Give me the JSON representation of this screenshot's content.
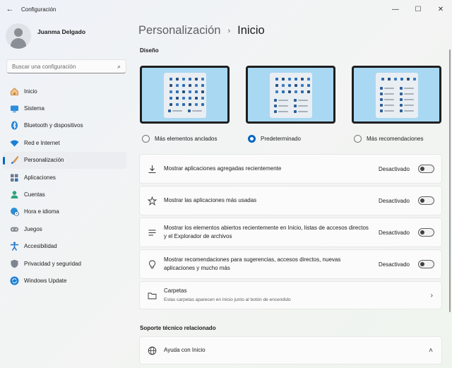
{
  "window": {
    "title": "Configuración",
    "back_icon": "←",
    "min_icon": "—",
    "max_icon": "☐",
    "close_icon": "✕"
  },
  "user": {
    "name": "Juanma Delgado"
  },
  "search": {
    "placeholder": "Buscar una configuración",
    "icon": "⌕"
  },
  "sidebar": {
    "items": [
      {
        "label": "Inicio",
        "icon": "home-icon",
        "color": "#d89a4a"
      },
      {
        "label": "Sistema",
        "icon": "monitor-icon",
        "color": "#0078d4"
      },
      {
        "label": "Bluetooth y dispositivos",
        "icon": "bluetooth-icon",
        "color": "#0078d4"
      },
      {
        "label": "Red e Internet",
        "icon": "wifi-icon",
        "color": "#0078d4"
      },
      {
        "label": "Personalización",
        "icon": "brush-icon",
        "color": "#e08c3a"
      },
      {
        "label": "Aplicaciones",
        "icon": "apps-icon",
        "color": "#3a6fb0"
      },
      {
        "label": "Cuentas",
        "icon": "person-icon",
        "color": "#2fa37c"
      },
      {
        "label": "Hora e idioma",
        "icon": "globe-clock-icon",
        "color": "#1a86c8"
      },
      {
        "label": "Juegos",
        "icon": "gamepad-icon",
        "color": "#7a7f86"
      },
      {
        "label": "Accesibilidad",
        "icon": "accessibility-icon",
        "color": "#1a73c8"
      },
      {
        "label": "Privacidad y seguridad",
        "icon": "shield-icon",
        "color": "#6b7280"
      },
      {
        "label": "Windows Update",
        "icon": "update-icon",
        "color": "#0078d4"
      }
    ],
    "active_index": 4
  },
  "breadcrumb": {
    "parent": "Personalización",
    "separator": "›",
    "current": "Inicio"
  },
  "layout_section": {
    "title": "Diseño",
    "options": [
      {
        "label": "Más elementos anclados",
        "selected": false
      },
      {
        "label": "Predeterminado",
        "selected": true
      },
      {
        "label": "Más recomendaciones",
        "selected": false
      }
    ]
  },
  "settings": [
    {
      "text": "Mostrar aplicaciones agregadas recientemente",
      "state": "Desactivado",
      "icon": "download-icon"
    },
    {
      "text": "Mostrar las aplicaciones más usadas",
      "state": "Desactivado",
      "icon": "star-icon"
    },
    {
      "text": "Mostrar los elementos abiertos recientemente en Inicio, listas de accesos directos y el Explorador de archivos",
      "state": "Desactivado",
      "icon": "list-icon"
    },
    {
      "text": "Mostrar recomendaciones para sugerencias, accesos directos, nuevas aplicaciones y mucho más",
      "state": "Desactivado",
      "icon": "lightbulb-icon"
    }
  ],
  "folders": {
    "title": "Carpetas",
    "subtitle": "Estas carpetas aparecen en Inicio junto al botón de encendido",
    "chevron": "›"
  },
  "support": {
    "title": "Soporte técnico relacionado",
    "help_label": "Ayuda con Inicio",
    "chevron": "˄"
  },
  "accent": "#0067c0"
}
